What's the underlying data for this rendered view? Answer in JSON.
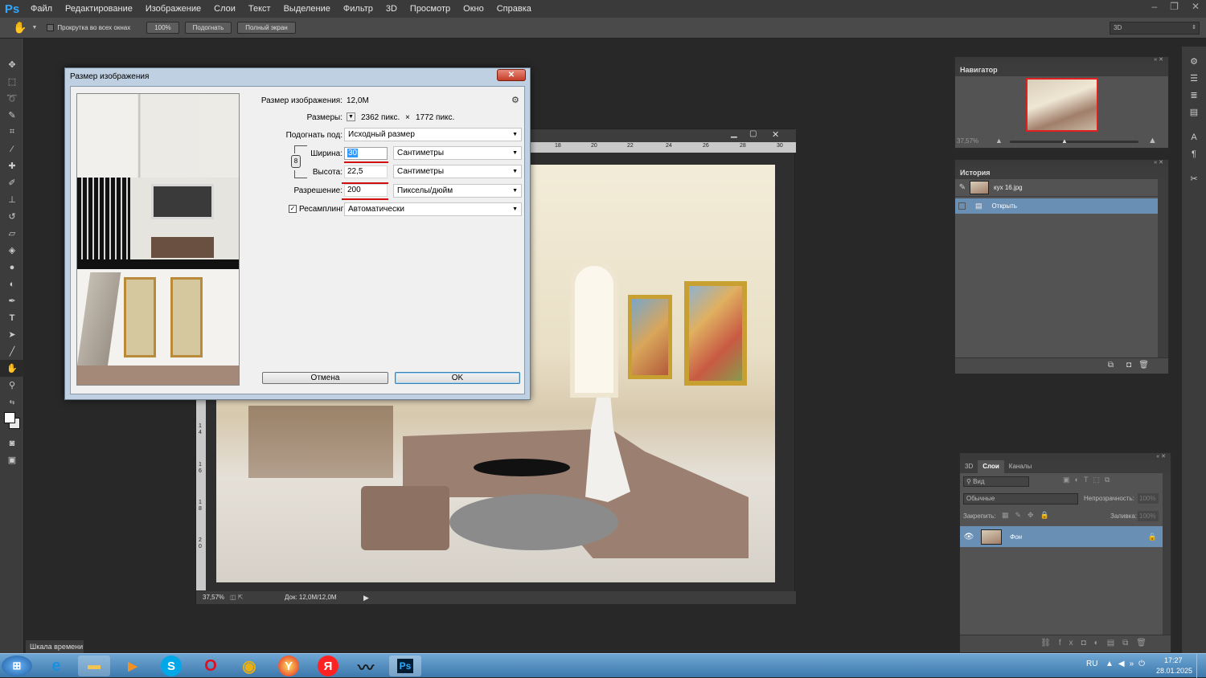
{
  "app": {
    "logo": "Ps"
  },
  "menu": [
    "Файл",
    "Редактирование",
    "Изображение",
    "Слои",
    "Текст",
    "Выделение",
    "Фильтр",
    "3D",
    "Просмотр",
    "Окно",
    "Справка"
  ],
  "options": {
    "scroll_all": "Прокрутка во всех окнах",
    "zoom100": "100%",
    "fit": "Подогнать",
    "fullscreen": "Полный экран",
    "workspace": "3D"
  },
  "navigator": {
    "title": "Навигатор",
    "zoom": "37,57%"
  },
  "history": {
    "title": "История",
    "items": [
      "кух 16.jpg",
      "Открыть"
    ]
  },
  "layers": {
    "tabs": [
      "3D",
      "Слои",
      "Каналы"
    ],
    "filter": "Вид",
    "blend": "Обычные",
    "opacity_label": "Непрозрачность:",
    "opacity": "100%",
    "lock_label": "Закрепить:",
    "fill_label": "Заливка:",
    "fill": "100%",
    "layer_name": "Фон"
  },
  "document": {
    "status_zoom": "37,57%",
    "doc_info": "Док: 12,0M/12,0M",
    "ruler_marks": [
      "18",
      "20",
      "22",
      "24",
      "26",
      "28",
      "30"
    ],
    "vruler_marks": [
      "1",
      "4",
      "1",
      "6",
      "1",
      "8",
      "2",
      "0"
    ]
  },
  "dialog": {
    "title": "Размер изображения",
    "size_label": "Размер изображения:",
    "size_value": "12,0M",
    "dims_label": "Размеры:",
    "dims_w": "2362 пикс.",
    "dims_x": "×",
    "dims_h": "1772 пикс.",
    "fit_label": "Подогнать под:",
    "fit_value": "Исходный размер",
    "width_label": "Ширина:",
    "width_value": "30",
    "width_unit": "Сантиметры",
    "height_label": "Высота:",
    "height_value": "22,5",
    "height_unit": "Сантиметры",
    "res_label": "Разрешение:",
    "res_value": "200",
    "res_unit": "Пикселы/дюйм",
    "resample_label": "Ресамплинг",
    "resample_value": "Автоматически",
    "cancel": "Отмена",
    "ok": "OK"
  },
  "timeline": "Шкала времени",
  "taskbar": {
    "lang": "RU",
    "time": "17:27",
    "date": "28.01.2025"
  },
  "colors": {
    "accent": "#31a8ff",
    "selection": "#6a8fb5",
    "red_underline": "#d01010"
  }
}
